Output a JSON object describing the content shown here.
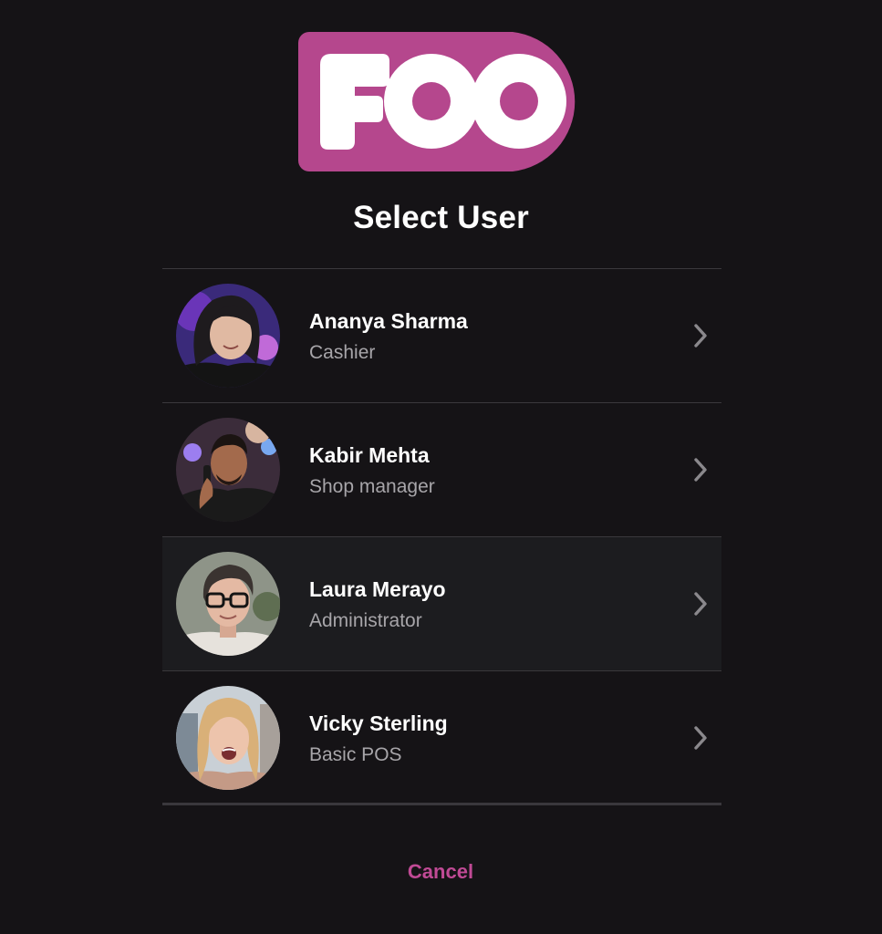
{
  "brand": {
    "logo_text": "FOO",
    "accent_color": "#b5478d",
    "link_color": "#c04a95"
  },
  "title": "Select User",
  "users": [
    {
      "name": "Ananya Sharma",
      "role": "Cashier",
      "avatar_icon": "user-avatar-photo"
    },
    {
      "name": "Kabir Mehta",
      "role": "Shop manager",
      "avatar_icon": "user-avatar-photo"
    },
    {
      "name": "Laura Merayo",
      "role": "Administrator",
      "avatar_icon": "user-avatar-photo"
    },
    {
      "name": "Vicky Sterling",
      "role": "Basic POS",
      "avatar_icon": "user-avatar-photo"
    }
  ],
  "row_icon": "chevron-right-icon",
  "cancel_label": "Cancel"
}
